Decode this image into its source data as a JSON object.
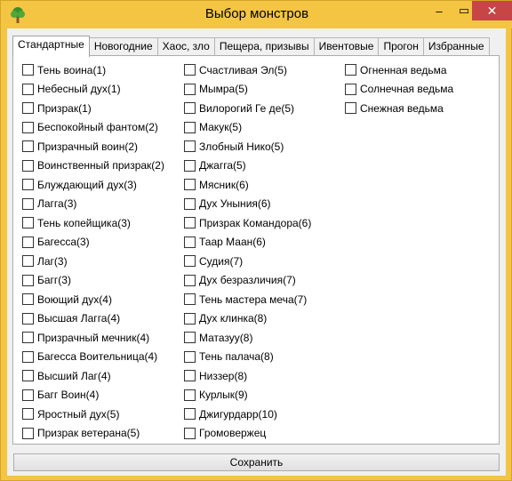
{
  "window": {
    "title": "Выбор монстров",
    "buttons": {
      "minimize": "–",
      "maximize": "▭",
      "close": "✕"
    },
    "accent_color": "#f4c542",
    "close_color": "#c74545"
  },
  "tabs": [
    {
      "label": "Стандартные",
      "active": true
    },
    {
      "label": "Новогодние",
      "active": false
    },
    {
      "label": "Хаос, зло",
      "active": false
    },
    {
      "label": "Пещера, призывы",
      "active": false
    },
    {
      "label": "Ивентовые",
      "active": false
    },
    {
      "label": "Прогон",
      "active": false
    },
    {
      "label": "Избранные",
      "active": false
    }
  ],
  "columns": [
    [
      "Тень воина(1)",
      "Небесный дух(1)",
      "Призрак(1)",
      "Беспокойный фантом(2)",
      "Призрачный воин(2)",
      "Воинственный призрак(2)",
      "Блуждающий дух(3)",
      "Лагга(3)",
      "Тень копейщика(3)",
      "Багесса(3)",
      "Лаг(3)",
      "Багг(3)",
      "Воющий дух(4)",
      "Высшая Лагга(4)",
      "Призрачный мечник(4)",
      "Багесса Воительница(4)",
      "Высший Лаг(4)",
      "Багг Воин(4)",
      "Яростный дух(5)",
      "Призрак ветерана(5)"
    ],
    [
      "Счастливая Эл(5)",
      "Мымра(5)",
      "Вилорогий Ге де(5)",
      "Макук(5)",
      "Злобный Нико(5)",
      "Джагга(5)",
      "Мясник(6)",
      "Дух Уныния(6)",
      "Призрак Командора(6)",
      "Таар Маан(6)",
      "Судия(7)",
      "Дух безразличия(7)",
      "Тень мастера меча(7)",
      "Дух клинка(8)",
      "Матазуу(8)",
      "Тень палача(8)",
      "Низзер(8)",
      "Курлык(9)",
      "Джигурдарр(10)",
      "Громовержец"
    ],
    [
      "Огненная ведьма",
      "Солнечная ведьма",
      "Снежная ведьма"
    ]
  ],
  "footer": {
    "save_label": "Сохранить"
  }
}
